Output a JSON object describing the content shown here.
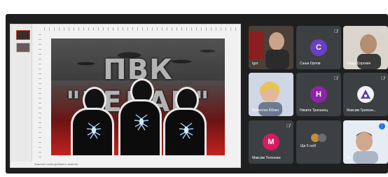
{
  "slide": {
    "title": "ПВК \"РЕДАН\""
  },
  "editor": {
    "status_text": "Заметки чтобы добавить заметки"
  },
  "participants": [
    {
      "name": "Igor",
      "type": "video",
      "muted": false
    },
    {
      "name": "Саша Орлов",
      "type": "avatar",
      "initial": "С",
      "avatar_color": "#6a3fc2",
      "muted": true
    },
    {
      "name": "Саша Сорокин",
      "type": "video",
      "muted": true
    },
    {
      "name": "Валентин Бблин",
      "type": "video",
      "muted": true
    },
    {
      "name": "Никита Тропанец",
      "type": "avatar",
      "initial": "Н",
      "avatar_color": "#8e24aa",
      "muted": true
    },
    {
      "name": "Максим Трапезн...",
      "type": "avatar",
      "initial": "",
      "avatar_color": "#f1f3f4",
      "muted": true
    },
    {
      "name": "Максим Тютюнюк",
      "type": "avatar",
      "initial": "М",
      "avatar_color": "#d81b60",
      "muted": true
    },
    {
      "name": "Ще 5 осіб",
      "type": "group",
      "muted": false
    },
    {
      "name": "Ви",
      "type": "video",
      "muted": false,
      "speaking": true
    }
  ],
  "icons": {
    "muted": "mic-off-icon",
    "speaking": "audio-level-icon"
  }
}
